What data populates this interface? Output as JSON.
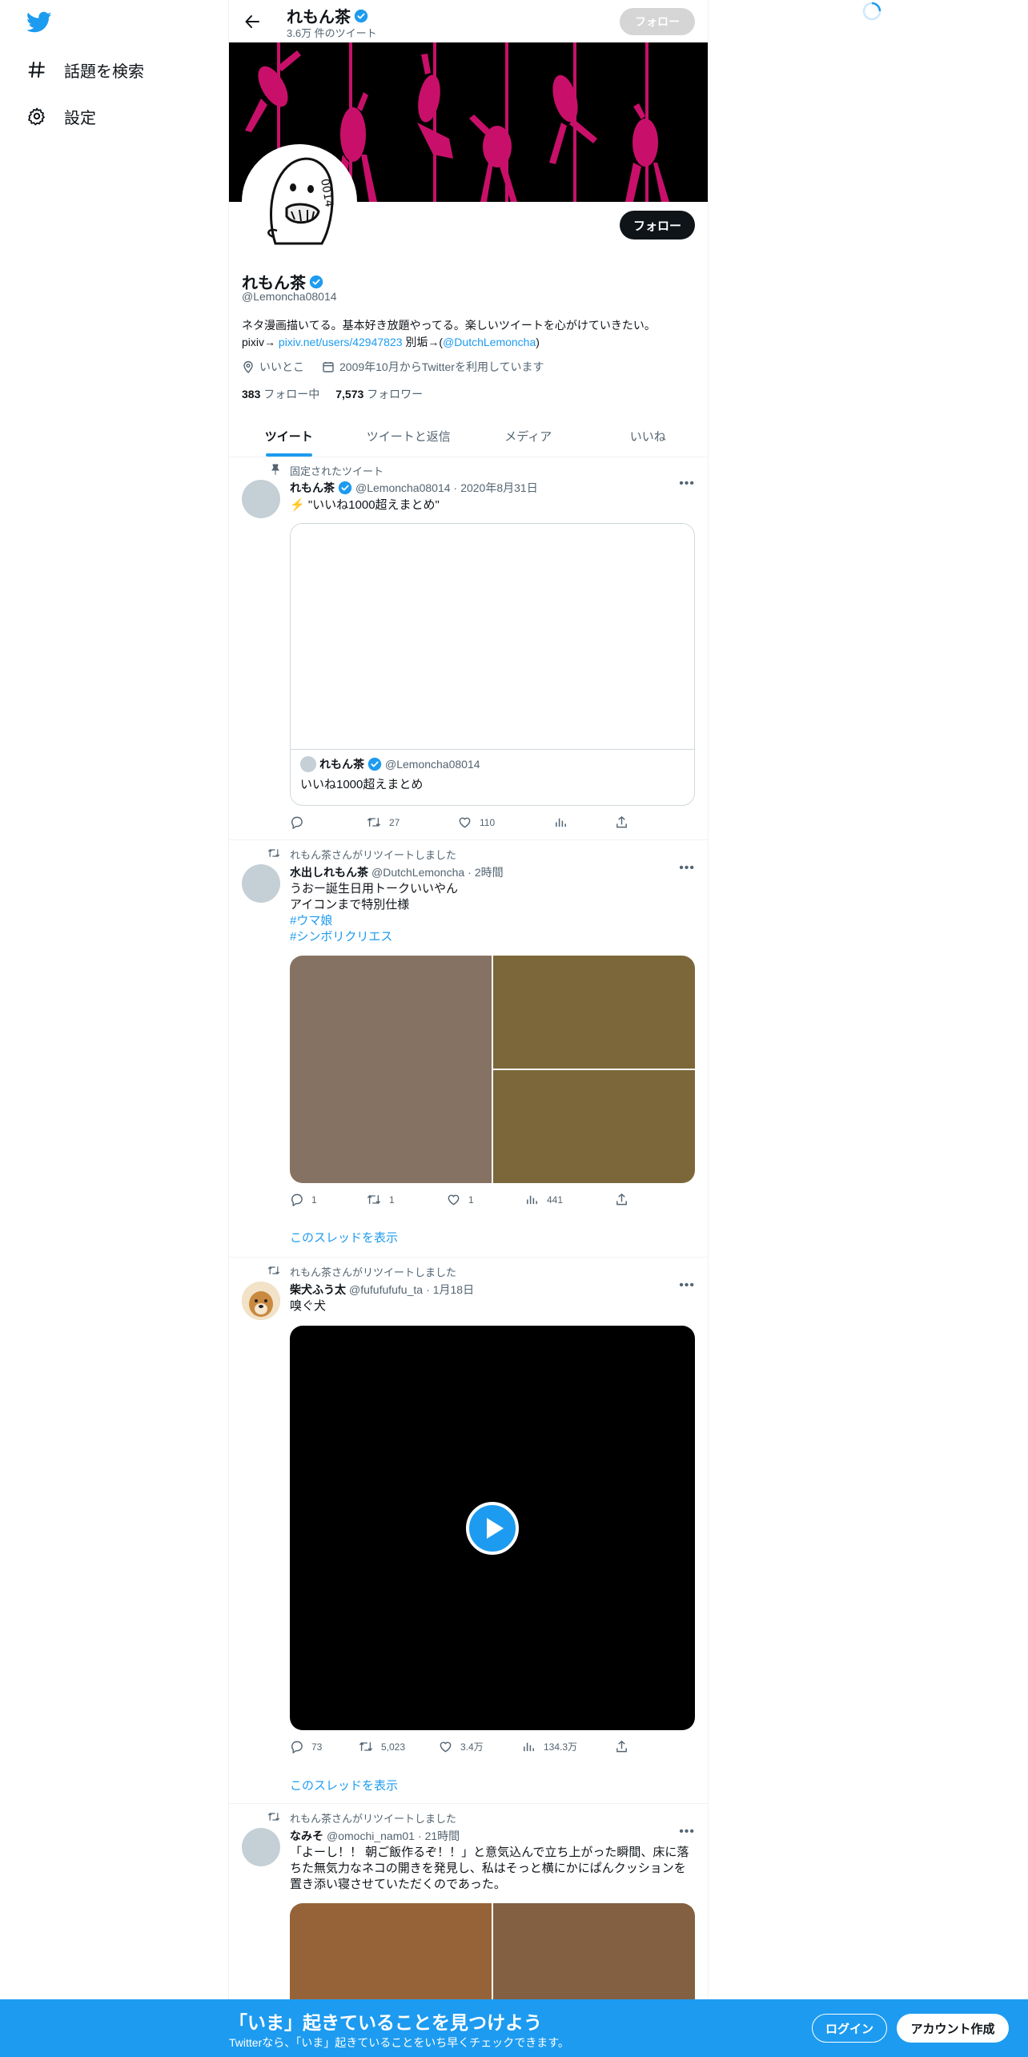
{
  "nav": {
    "explore_label": "話題を検索",
    "settings_label": "設定"
  },
  "header": {
    "title": "れもん茶",
    "tweet_count": "3.6万 件のツイート",
    "follow_label": "フォロー"
  },
  "profile": {
    "name": "れもん茶",
    "handle": "@Lemoncha08014",
    "follow_label": "フォロー",
    "bio_line1": "ネタ漫画描いてる。基本好き放題やってる。楽しいツイートを心がけていきたい。",
    "bio_pixiv_prefix": "pixiv→ ",
    "bio_pixiv_link": "pixiv.net/users/42947823",
    "bio_alt_prefix": " 別垢→(",
    "bio_alt_link": "@DutchLemoncha",
    "bio_alt_suffix": ")",
    "location": "いいとこ",
    "joined": "2009年10月からTwitterを利用しています",
    "following_count": "383",
    "following_label": "フォロー中",
    "followers_count": "7,573",
    "followers_label": "フォロワー"
  },
  "tabs": [
    {
      "label": "ツイート",
      "active": true
    },
    {
      "label": "ツイートと返信",
      "active": false
    },
    {
      "label": "メディア",
      "active": false
    },
    {
      "label": "いいね",
      "active": false
    }
  ],
  "tweets": [
    {
      "context": "固定されたツイート",
      "name": "れもん茶",
      "handle": "@Lemoncha08014",
      "time": "2020年8月31日",
      "text": "⚡️ \"いいね1000超えまとめ\"",
      "quote_name": "れもん茶",
      "quote_handle": "@Lemoncha08014",
      "quote_text": "いいね1000超えまとめ",
      "retweets": "27",
      "likes": "110"
    },
    {
      "context": "れもん茶さんがリツイートしました",
      "name": "水出しれもん茶",
      "handle": "@DutchLemoncha",
      "time": "2時間",
      "text_line1": "うおー誕生日用トークいいやん",
      "text_line2": "アイコンまで特別仕様",
      "hashtag1": "#ウマ娘",
      "hashtag2": "#シンボリクリエス",
      "replies": "1",
      "retweets": "1",
      "likes": "1",
      "views": "441",
      "show_thread": "このスレッドを表示"
    },
    {
      "context": "れもん茶さんがリツイートしました",
      "name": "柴犬ふう太",
      "handle": "@fufufufufu_ta",
      "time": "1月18日",
      "text": "嗅ぐ犬",
      "replies": "73",
      "retweets": "5,023",
      "likes": "3.4万",
      "views": "134.3万",
      "show_thread": "このスレッドを表示"
    },
    {
      "context": "れもん茶さんがリツイートしました",
      "name": "なみそ",
      "handle": "@omochi_nam01",
      "time": "21時間",
      "text": "「よーし！！ 朝ご飯作るぞ！！」と意気込んで立ち上がった瞬間、床に落ちた無気力なネコの開きを発見し、私はそっと横にかにぱんクッションを置き添い寝させていただくのであった。"
    }
  ],
  "bottom_bar": {
    "title": "「いま」起きていることを見つけよう",
    "subtitle": "Twitterなら、「いま」起きていることをいち早くチェックできます。",
    "login_label": "ログイン",
    "signup_label": "アカウント作成"
  },
  "colors": {
    "accent": "#1d9bf0",
    "banner_pink": "#c8106a",
    "text_primary": "#0f1419",
    "text_secondary": "#536471"
  }
}
